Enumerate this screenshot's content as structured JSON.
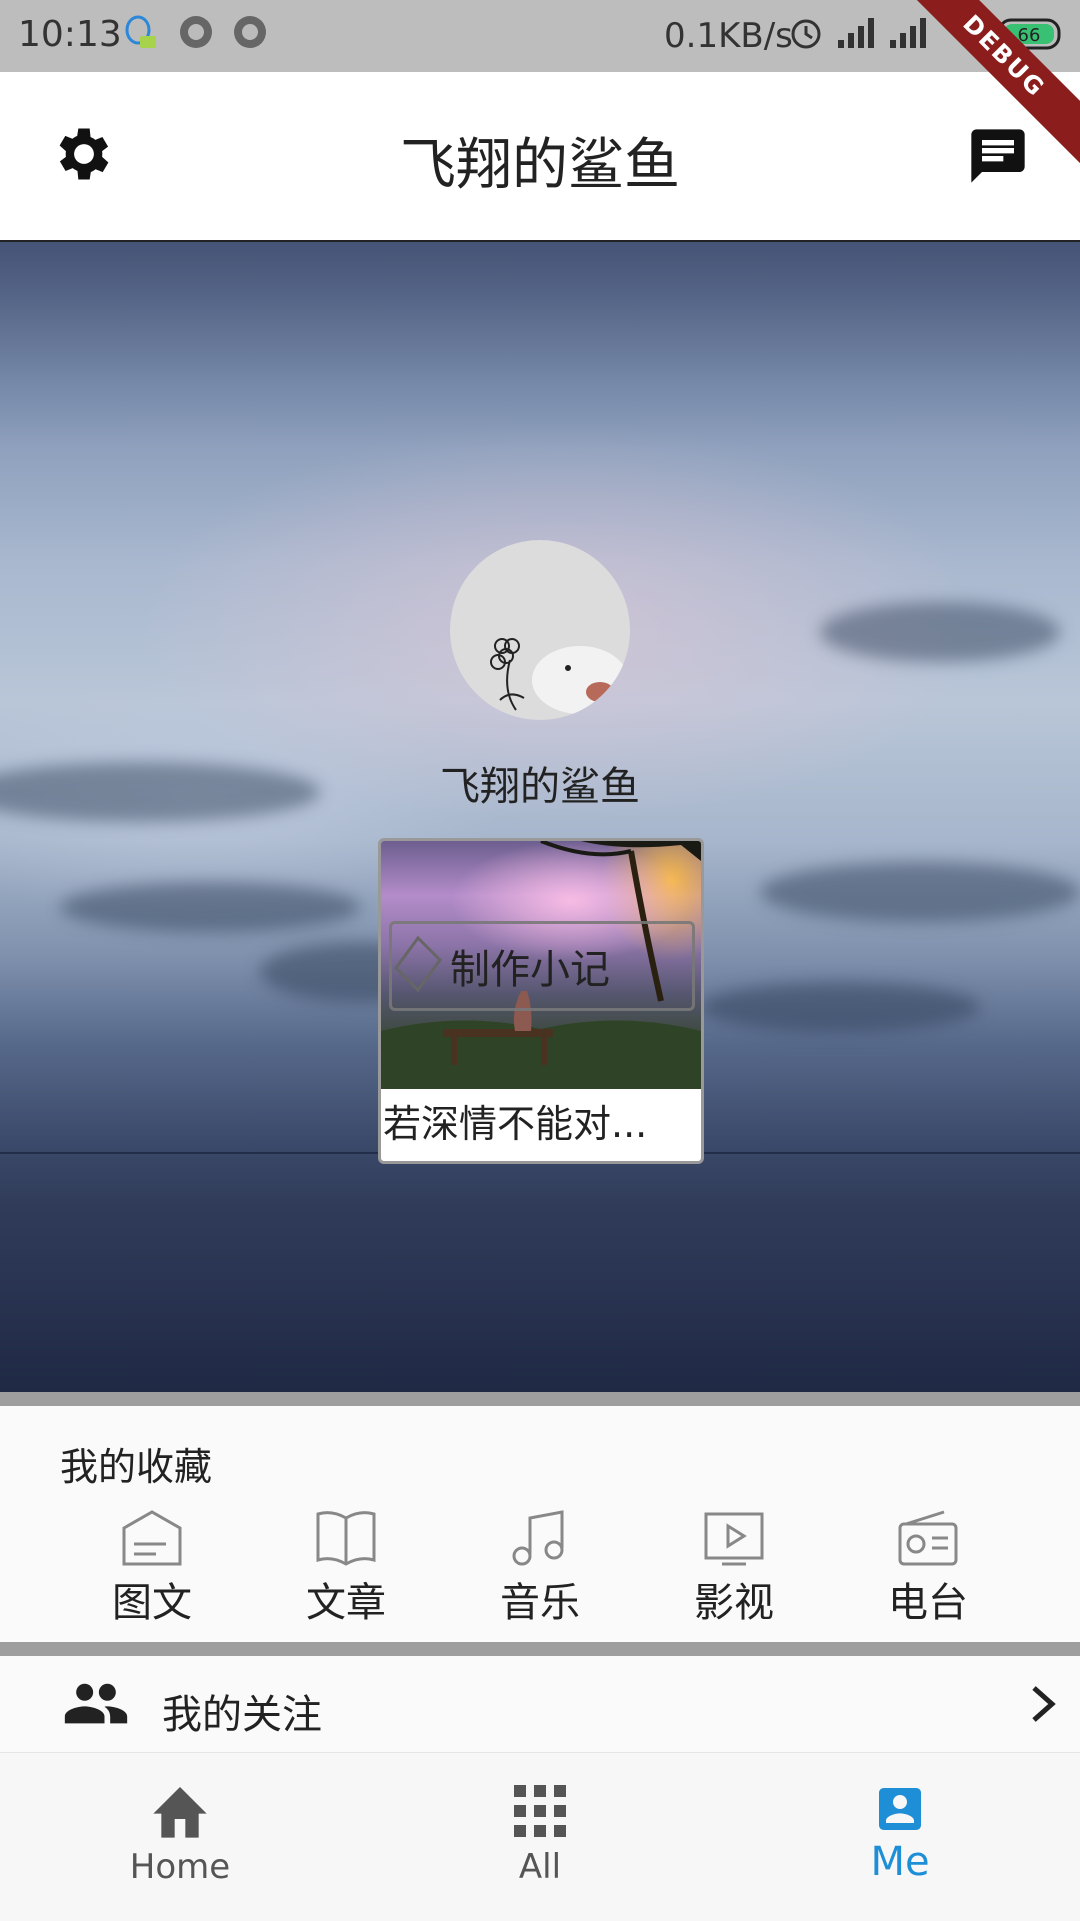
{
  "status_bar": {
    "time": "10:13",
    "network_speed": "0.1KB/s",
    "battery": "66",
    "debug_banner": "DEBUG",
    "icons": [
      "qq-icon",
      "record-icon",
      "record-icon",
      "alarm-icon",
      "signal-icon",
      "signal-icon",
      "wifi-icon",
      "battery-icon"
    ]
  },
  "app_bar": {
    "title": "飞翔的鲨鱼",
    "left_icon": "settings-icon",
    "right_icon": "message-icon"
  },
  "profile": {
    "username": "飞翔的鲨鱼",
    "note_card": {
      "button_label": "制作小记",
      "caption": "若深情不能对..."
    }
  },
  "favorites": {
    "heading": "我的收藏",
    "items": [
      {
        "label": "图文",
        "icon": "image-text-icon"
      },
      {
        "label": "文章",
        "icon": "book-icon"
      },
      {
        "label": "音乐",
        "icon": "music-icon"
      },
      {
        "label": "影视",
        "icon": "video-icon"
      },
      {
        "label": "电台",
        "icon": "radio-icon"
      }
    ]
  },
  "follow": {
    "label": "我的关注",
    "icon": "people-icon"
  },
  "bottom_nav": {
    "active": "Me",
    "items": [
      {
        "label": "Home",
        "icon": "home-icon"
      },
      {
        "label": "All",
        "icon": "apps-grid-icon"
      },
      {
        "label": "Me",
        "icon": "account-box-icon"
      }
    ]
  },
  "colors": {
    "accent": "#1e8fd6",
    "divider": "#9e9e9e",
    "appbar": "#ffffff"
  }
}
